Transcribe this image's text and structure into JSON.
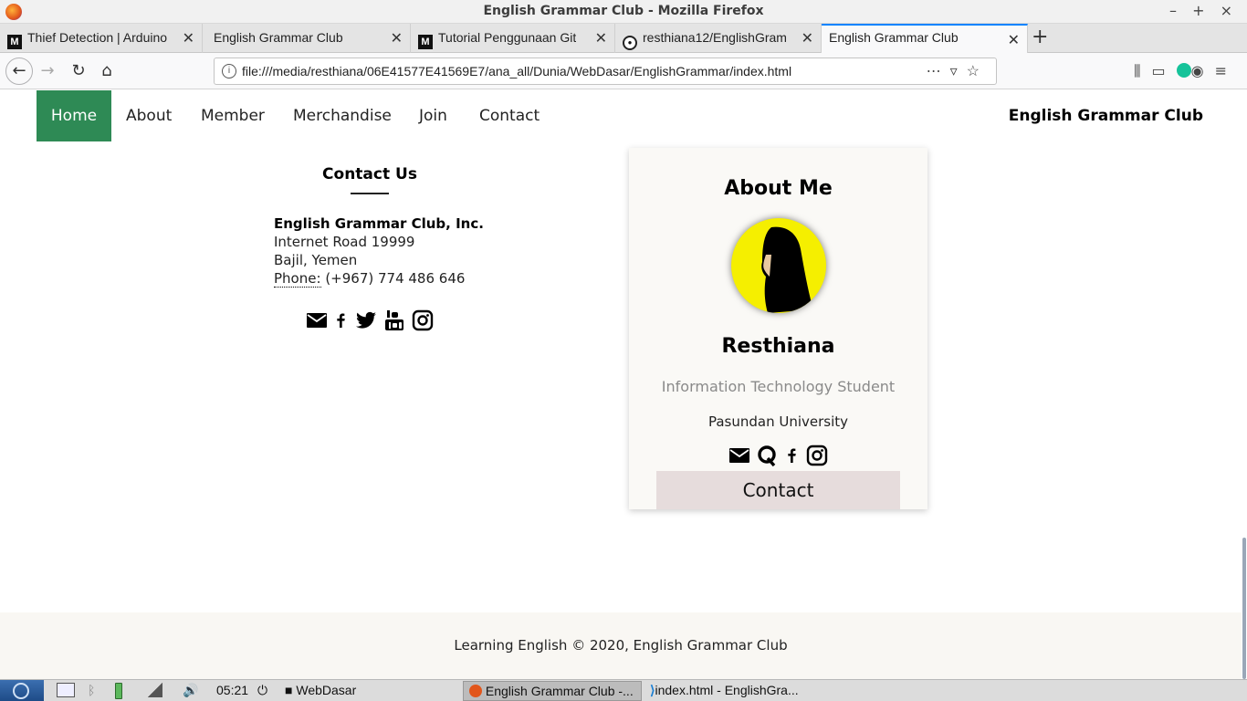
{
  "window": {
    "title": "English Grammar Club - Mozilla Firefox",
    "controls": [
      "–",
      "+",
      "×"
    ]
  },
  "tabs": [
    {
      "label": "Thief Detection | Arduino",
      "favicon": "M"
    },
    {
      "label": "English Grammar Club",
      "favicon": ""
    },
    {
      "label": "Tutorial Penggunaan Git",
      "favicon": "M"
    },
    {
      "label": "resthiana12/EnglishGram",
      "favicon": "GH"
    },
    {
      "label": "English Grammar Club",
      "favicon": ""
    }
  ],
  "navigation": {
    "url": "file:///media/resthiana/06E41577E41569E7/ana_all/Dunia/WebDasar/EnglishGrammar/index.html"
  },
  "site": {
    "nav": {
      "home": "Home",
      "about": "About",
      "member": "Member",
      "merchandise": "Merchandise",
      "join": "Join",
      "contact": "Contact",
      "brand": "English Grammar Club"
    },
    "contact": {
      "heading": "Contact Us",
      "org": "English Grammar Club, Inc.",
      "street": "Internet Road 19999",
      "city": "Bajil, Yemen",
      "phone_label": "Phone:",
      "phone_value": "(+967) 774 486 646"
    },
    "card": {
      "title": "About Me",
      "name": "Resthiana",
      "role": "Information Technology Student",
      "university": "Pasundan University",
      "button": "Contact"
    },
    "footer": "Learning English © 2020, English Grammar Club"
  },
  "taskbar": {
    "clock": "05:21",
    "tasks": [
      {
        "label": "WebDasar"
      },
      {
        "label": "English Grammar Club -..."
      },
      {
        "label": "index.html - EnglishGra..."
      }
    ]
  },
  "colors": {
    "nav_active": "#2e8a55",
    "avatar_bg": "#f5ef00",
    "contact_button_bg": "#e6dcdc",
    "footer_bg": "#f9f7f3"
  }
}
